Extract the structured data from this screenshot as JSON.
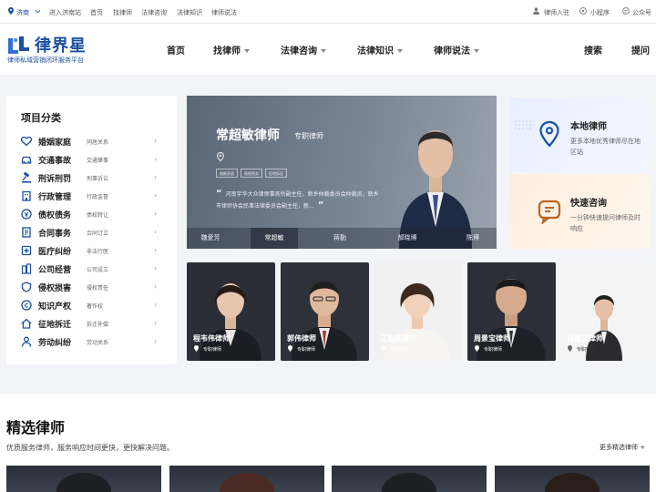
{
  "topbar": {
    "city": "济南",
    "links": [
      "进入济南站",
      "首页",
      "找律师",
      "法律咨询",
      "法律知识",
      "律师说法"
    ],
    "lawyer_login": "律师入驻",
    "mini_program": "小程序",
    "official_account": "公众号"
  },
  "brand": {
    "name": "律界星",
    "slogan": "律师私域营销闭环服务平台",
    "color": "#1a4fa3"
  },
  "nav": {
    "items": [
      {
        "label": "首页",
        "dropdown": false
      },
      {
        "label": "找律师",
        "dropdown": true
      },
      {
        "label": "法律咨询",
        "dropdown": true
      },
      {
        "label": "法律知识",
        "dropdown": true
      },
      {
        "label": "律师说法",
        "dropdown": true
      }
    ],
    "search": "搜索",
    "ask": "提问"
  },
  "categories": {
    "title": "项目分类",
    "items": [
      {
        "label": "婚姻家庭",
        "sub": "同居关系",
        "icon": "heart-icon"
      },
      {
        "label": "交通事故",
        "sub": "交通肇事",
        "icon": "car-icon"
      },
      {
        "label": "刑诉刑罚",
        "sub": "刑事诉讼",
        "icon": "gavel-icon"
      },
      {
        "label": "行政管理",
        "sub": "行政监督",
        "icon": "building-icon"
      },
      {
        "label": "债权债务",
        "sub": "债权转让",
        "icon": "coin-icon"
      },
      {
        "label": "合同事务",
        "sub": "合同订立",
        "icon": "contract-icon"
      },
      {
        "label": "医疗纠纷",
        "sub": "非法行医",
        "icon": "medical-icon"
      },
      {
        "label": "公司经营",
        "sub": "公司设立",
        "icon": "company-icon"
      },
      {
        "label": "侵权损害",
        "sub": "侵权责任",
        "icon": "shield-icon"
      },
      {
        "label": "知识产权",
        "sub": "著作权",
        "icon": "ip-icon"
      },
      {
        "label": "征地拆迁",
        "sub": "拆迁补偿",
        "icon": "house-icon"
      },
      {
        "label": "劳动纠纷",
        "sub": "劳动关系",
        "icon": "worker-icon"
      }
    ]
  },
  "hero": {
    "name": "常超敏律师",
    "title": "专职律师",
    "tags": [
      "婚姻家庭",
      "债权债务",
      "征地拆迁"
    ],
    "quote": "河南宇华大众律师事务所副主任，新乡仲裁委员会仲裁员，新乡市律师协会民事法律委员会副主任，新...",
    "tabs": [
      "魏爱芳",
      "常超敏",
      "蒋勤",
      "郝晓博",
      "陈博"
    ],
    "active_tab": 1
  },
  "promos": [
    {
      "title": "本地律师",
      "desc": "更多本地优秀律师尽在地区站",
      "icon": "location-pin-icon",
      "color": "#1a4fa3"
    },
    {
      "title": "快速咨询",
      "desc": "一分钟快速提问律师及时响应",
      "icon": "chat-icon",
      "color": "#b8651c"
    }
  ],
  "lawyers": [
    {
      "name": "程韦伟律师",
      "title": "专职律师"
    },
    {
      "name": "郭伟律师",
      "title": "专职律师"
    },
    {
      "name": "江南燕律师",
      "title": "专职律师"
    },
    {
      "name": "周景宝律师",
      "title": "专职律师"
    },
    {
      "name": "马德义律师",
      "title": "专职律师"
    }
  ],
  "featured": {
    "title": "精选律师",
    "subtitle": "优质服务律师，服务响应时间更快，更快解决问题。",
    "more": "更多精选律师 +"
  }
}
